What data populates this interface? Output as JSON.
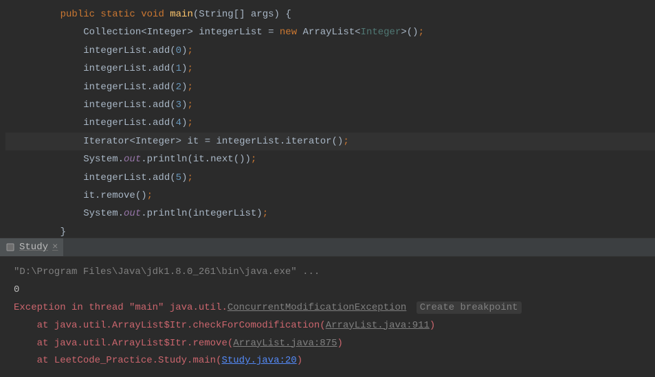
{
  "editor": {
    "lines": [
      {
        "indent": 1,
        "tokens": [
          {
            "t": "public ",
            "c": "kw"
          },
          {
            "t": "static ",
            "c": "kw"
          },
          {
            "t": "void ",
            "c": "kw"
          },
          {
            "t": "main",
            "c": "method"
          },
          {
            "t": "(",
            "c": "paren"
          },
          {
            "t": "String",
            "c": "type"
          },
          {
            "t": "[] ",
            "c": "type"
          },
          {
            "t": "args",
            "c": "ident"
          },
          {
            "t": ") ",
            "c": "paren"
          },
          {
            "t": "{",
            "c": "paren"
          }
        ],
        "highlighted": false
      },
      {
        "indent": 2,
        "tokens": [
          {
            "t": "Collection",
            "c": "type"
          },
          {
            "t": "<",
            "c": "type"
          },
          {
            "t": "Integer",
            "c": "type"
          },
          {
            "t": "> ",
            "c": "type"
          },
          {
            "t": "integerList ",
            "c": "ident"
          },
          {
            "t": "= ",
            "c": "ident"
          },
          {
            "t": "new ",
            "c": "kw"
          },
          {
            "t": "ArrayList",
            "c": "type"
          },
          {
            "t": "<",
            "c": "type"
          },
          {
            "t": "Integer",
            "c": "generic"
          },
          {
            "t": ">()",
            "c": "paren"
          },
          {
            "t": ";",
            "c": "punct"
          }
        ],
        "highlighted": false
      },
      {
        "indent": 2,
        "tokens": [
          {
            "t": "integerList.add",
            "c": "ident"
          },
          {
            "t": "(",
            "c": "paren"
          },
          {
            "t": "0",
            "c": "num"
          },
          {
            "t": ")",
            "c": "paren"
          },
          {
            "t": ";",
            "c": "punct"
          }
        ],
        "highlighted": false
      },
      {
        "indent": 2,
        "tokens": [
          {
            "t": "integerList.add",
            "c": "ident"
          },
          {
            "t": "(",
            "c": "paren"
          },
          {
            "t": "1",
            "c": "num"
          },
          {
            "t": ")",
            "c": "paren"
          },
          {
            "t": ";",
            "c": "punct"
          }
        ],
        "highlighted": false
      },
      {
        "indent": 2,
        "tokens": [
          {
            "t": "integerList.add",
            "c": "ident"
          },
          {
            "t": "(",
            "c": "paren"
          },
          {
            "t": "2",
            "c": "num"
          },
          {
            "t": ")",
            "c": "paren"
          },
          {
            "t": ";",
            "c": "punct"
          }
        ],
        "highlighted": false
      },
      {
        "indent": 2,
        "tokens": [
          {
            "t": "integerList.add",
            "c": "ident"
          },
          {
            "t": "(",
            "c": "paren"
          },
          {
            "t": "3",
            "c": "num"
          },
          {
            "t": ")",
            "c": "paren"
          },
          {
            "t": ";",
            "c": "punct"
          }
        ],
        "highlighted": false
      },
      {
        "indent": 2,
        "tokens": [
          {
            "t": "integerList.add",
            "c": "ident"
          },
          {
            "t": "(",
            "c": "paren"
          },
          {
            "t": "4",
            "c": "num"
          },
          {
            "t": ")",
            "c": "paren"
          },
          {
            "t": ";",
            "c": "punct"
          }
        ],
        "highlighted": false
      },
      {
        "indent": 2,
        "tokens": [
          {
            "t": "Iterator",
            "c": "type"
          },
          {
            "t": "<",
            "c": "type"
          },
          {
            "t": "Integer",
            "c": "type"
          },
          {
            "t": "> ",
            "c": "type"
          },
          {
            "t": "it ",
            "c": "ident"
          },
          {
            "t": "= ",
            "c": "ident"
          },
          {
            "t": "integerList.iterator",
            "c": "ident"
          },
          {
            "t": "()",
            "c": "paren"
          },
          {
            "t": ";",
            "c": "punct"
          }
        ],
        "highlighted": true
      },
      {
        "indent": 2,
        "tokens": [
          {
            "t": "System.",
            "c": "ident"
          },
          {
            "t": "out",
            "c": "field-italic"
          },
          {
            "t": ".println",
            "c": "ident"
          },
          {
            "t": "(",
            "c": "paren"
          },
          {
            "t": "it.next",
            "c": "ident"
          },
          {
            "t": "())",
            "c": "paren"
          },
          {
            "t": ";",
            "c": "punct"
          }
        ],
        "highlighted": false
      },
      {
        "indent": 2,
        "tokens": [
          {
            "t": "integerList.add",
            "c": "ident"
          },
          {
            "t": "(",
            "c": "paren"
          },
          {
            "t": "5",
            "c": "num"
          },
          {
            "t": ")",
            "c": "paren"
          },
          {
            "t": ";",
            "c": "punct"
          }
        ],
        "highlighted": false
      },
      {
        "indent": 2,
        "tokens": [
          {
            "t": "it.remove",
            "c": "ident"
          },
          {
            "t": "()",
            "c": "paren"
          },
          {
            "t": ";",
            "c": "punct"
          }
        ],
        "highlighted": false
      },
      {
        "indent": 2,
        "tokens": [
          {
            "t": "System.",
            "c": "ident"
          },
          {
            "t": "out",
            "c": "field-italic"
          },
          {
            "t": ".println",
            "c": "ident"
          },
          {
            "t": "(",
            "c": "paren"
          },
          {
            "t": "integerList",
            "c": "ident"
          },
          {
            "t": ")",
            "c": "paren"
          },
          {
            "t": ";",
            "c": "punct"
          }
        ],
        "highlighted": false
      },
      {
        "indent": 1,
        "tokens": [
          {
            "t": "}",
            "c": "paren"
          }
        ],
        "highlighted": false
      }
    ]
  },
  "tab": {
    "name": "Study"
  },
  "console": {
    "cmdline": "\"D:\\Program Files\\Java\\jdk1.8.0_261\\bin\\java.exe\" ...",
    "output": "0",
    "exception_prefix": "Exception in thread \"main\" ",
    "exception_class": "java.util.",
    "exception_link": "ConcurrentModificationException",
    "breakpoint_action": "Create breakpoint",
    "stack": [
      {
        "at": "    at ",
        "loc": "java.util.ArrayList$Itr.checkForComodification",
        "open": "(",
        "link": "ArrayList.java:911",
        "close": ")"
      },
      {
        "at": "    at ",
        "loc": "java.util.ArrayList$Itr.remove",
        "open": "(",
        "link": "ArrayList.java:875",
        "close": ")"
      },
      {
        "at": "    at ",
        "loc": "LeetCode_Practice.Study.main",
        "open": "(",
        "link": "Study.java:20",
        "close": ")",
        "blue": true
      }
    ]
  }
}
